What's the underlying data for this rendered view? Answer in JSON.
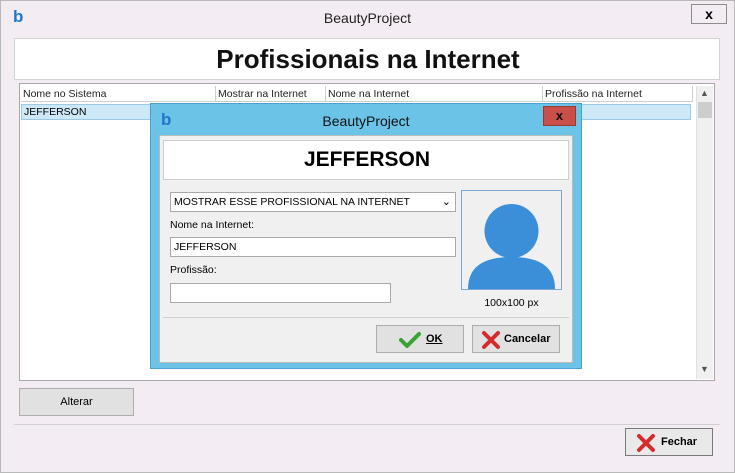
{
  "window": {
    "title": "BeautyProject",
    "close_label": "x",
    "logo": "b"
  },
  "page": {
    "title": "Profissionais na Internet"
  },
  "grid": {
    "columns": [
      "Nome no Sistema",
      "Mostrar na Internet",
      "Nome na Internet",
      "Profissão na Internet"
    ],
    "rows": [
      [
        "JEFFERSON",
        "",
        "",
        ""
      ]
    ]
  },
  "buttons": {
    "alterar": "Alterar",
    "fechar": "Fechar"
  },
  "dialog": {
    "title": "BeautyProject",
    "logo": "b",
    "close_label": "x",
    "name": "JEFFERSON",
    "show_option": "MOSTRAR ESSE PROFISSIONAL NA INTERNET",
    "nome_label": "Nome na Internet:",
    "nome_value": "JEFFERSON",
    "profissao_label": "Profissão:",
    "profissao_value": "",
    "avatar_caption": "100x100 px",
    "ok_label": "OK",
    "cancel_label": "Cancelar",
    "avatar_icon": "user-silhouette-icon",
    "avatar_color": "#3b8fd8"
  },
  "colors": {
    "window_bg": "#f3ecf3",
    "dialog_frame": "#6bc3e7",
    "selected_row": "#cde8f7",
    "close_red": "#c9504a"
  }
}
